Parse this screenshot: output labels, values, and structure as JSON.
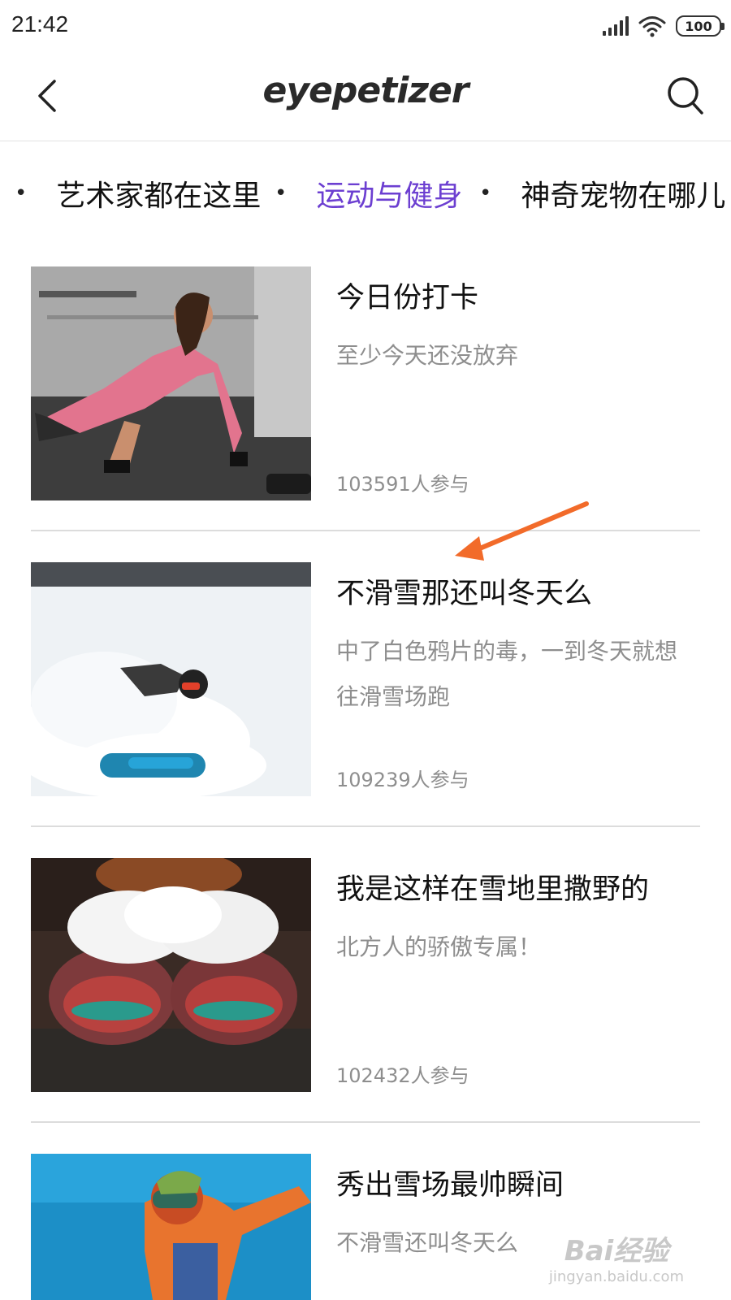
{
  "status_bar": {
    "time": "21:42",
    "battery": "100",
    "icons": [
      "signal-icon",
      "wifi-icon",
      "battery-icon"
    ]
  },
  "nav": {
    "logo": "eyepetizer",
    "back_icon": "chevron-left-icon",
    "search_icon": "search-icon"
  },
  "tabs": [
    {
      "label": "艺术家都在这里",
      "active": false
    },
    {
      "label": "运动与健身",
      "active": true
    },
    {
      "label": "神奇宠物在哪儿",
      "active": false
    }
  ],
  "cards": [
    {
      "title": "今日份打卡",
      "desc": "至少今天还没放弃",
      "count": "103591人参与",
      "image": "fitness-pushup-photo"
    },
    {
      "title": "不滑雪那还叫冬天么",
      "desc": "中了白色鸦片的毒，一到冬天就想往滑雪场跑",
      "count": "109239人参与",
      "image": "snowboarder-photo"
    },
    {
      "title": "我是这样在雪地里撒野的",
      "desc": "北方人的骄傲专属！",
      "count": "102432人参与",
      "image": "snow-mittens-photo"
    },
    {
      "title": "秀出雪场最帅瞬间",
      "desc": "不滑雪还叫冬天么",
      "count": "",
      "image": "skier-jump-photo"
    }
  ],
  "watermark": {
    "main": "Bai经验",
    "sub": "jingyan.baidu.com"
  },
  "colors": {
    "active_tab": "#6c3fd1",
    "annotation_arrow": "#f26b2a",
    "secondary_text": "#8e8e8e"
  }
}
